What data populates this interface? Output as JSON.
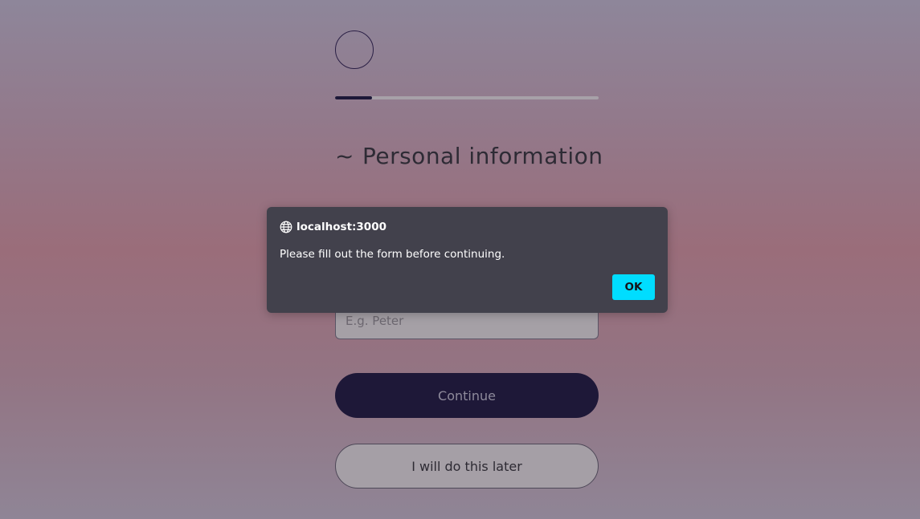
{
  "progress": {
    "value": 0.14
  },
  "header": {
    "title_prefix": "~",
    "title": "Personal information"
  },
  "form": {
    "name_placeholder": "E.g. Peter",
    "name_value": ""
  },
  "actions": {
    "continue_label": "Continue",
    "later_label": "I will do this later"
  },
  "dialog": {
    "origin": "localhost:3000",
    "message": "Please fill out the form before continuing.",
    "ok_label": "OK",
    "icon": "globe-icon"
  }
}
